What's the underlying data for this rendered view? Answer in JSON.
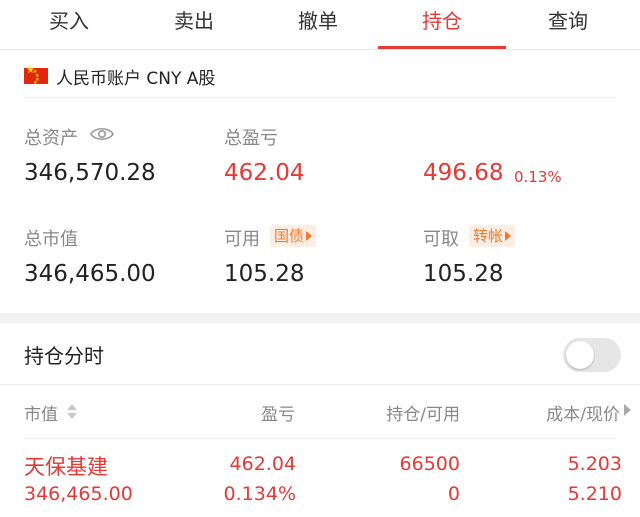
{
  "tabs": [
    {
      "label": "买入",
      "active": false
    },
    {
      "label": "卖出",
      "active": false
    },
    {
      "label": "撤单",
      "active": false
    },
    {
      "label": "持仓",
      "active": true
    },
    {
      "label": "查询",
      "active": false
    }
  ],
  "account": {
    "flag_icon": "china-flag-icon",
    "label": "人民币账户 CNY A股"
  },
  "summary": {
    "total_assets_label": "总资产",
    "total_assets_value": "346,570.28",
    "total_pnl_label": "总盈亏",
    "total_pnl_value": "462.04",
    "day_pnl_value": "496.68",
    "day_pnl_percent": "0.13%",
    "market_value_label": "总市值",
    "market_value_value": "346,465.00",
    "available_label": "可用",
    "available_badge": "国债",
    "available_value": "105.28",
    "withdrawable_label": "可取",
    "withdrawable_badge": "转帐",
    "withdrawable_value": "105.28"
  },
  "intraday": {
    "title": "持仓分时",
    "toggle_on": false
  },
  "table": {
    "headers": {
      "market_value": "市值",
      "pnl": "盈亏",
      "position": "持仓/可用",
      "cost_price": "成本/现价"
    },
    "rows": [
      {
        "name": "天保基建",
        "market_value": "346,465.00",
        "pnl": "462.04",
        "pnl_percent": "0.134%",
        "position": "66500",
        "available": "0",
        "cost": "5.203",
        "price": "5.210"
      }
    ]
  },
  "colors": {
    "accent_red": "#e53935",
    "badge_orange": "#f07a2b",
    "label_gray": "#888888"
  }
}
